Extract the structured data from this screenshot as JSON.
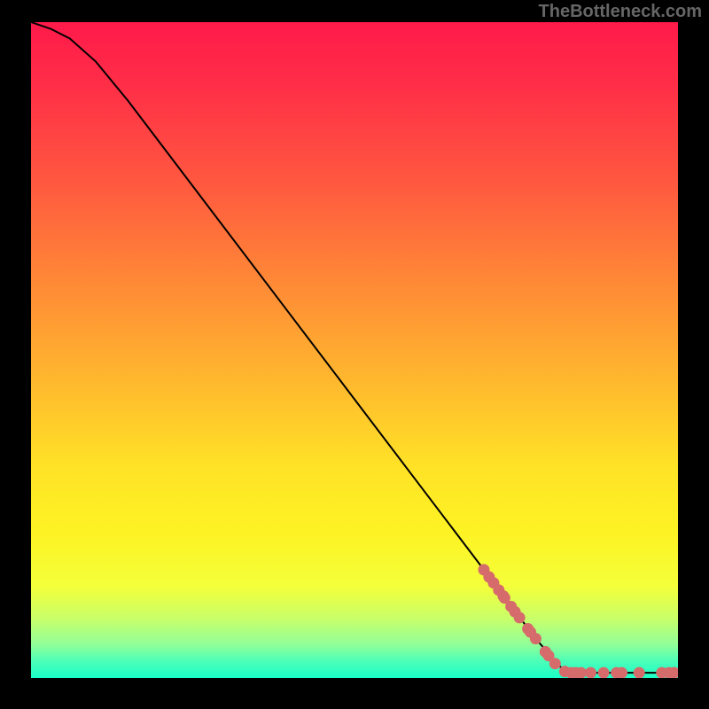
{
  "watermark": "TheBottleneck.com",
  "chart_data": {
    "type": "line",
    "title": "",
    "xlabel": "",
    "ylabel": "",
    "xlim": [
      0,
      100
    ],
    "ylim": [
      0,
      100
    ],
    "gradient_stops": [
      {
        "offset": 0.0,
        "color": "#ff1a4a"
      },
      {
        "offset": 0.1,
        "color": "#ff2f47"
      },
      {
        "offset": 0.25,
        "color": "#ff5a3f"
      },
      {
        "offset": 0.4,
        "color": "#ff8a36"
      },
      {
        "offset": 0.55,
        "color": "#ffb92e"
      },
      {
        "offset": 0.68,
        "color": "#ffe326"
      },
      {
        "offset": 0.78,
        "color": "#fdf324"
      },
      {
        "offset": 0.86,
        "color": "#f4ff3a"
      },
      {
        "offset": 0.91,
        "color": "#c8ff6a"
      },
      {
        "offset": 0.95,
        "color": "#8fff9a"
      },
      {
        "offset": 0.975,
        "color": "#4affb8"
      },
      {
        "offset": 1.0,
        "color": "#1affc8"
      }
    ],
    "curve": [
      {
        "x": 0,
        "y": 100
      },
      {
        "x": 3,
        "y": 99
      },
      {
        "x": 6,
        "y": 97.5
      },
      {
        "x": 10,
        "y": 94
      },
      {
        "x": 15,
        "y": 88
      },
      {
        "x": 20,
        "y": 81.5
      },
      {
        "x": 30,
        "y": 68.5
      },
      {
        "x": 40,
        "y": 55.5
      },
      {
        "x": 50,
        "y": 42.5
      },
      {
        "x": 60,
        "y": 29.5
      },
      {
        "x": 70,
        "y": 16.5
      },
      {
        "x": 78,
        "y": 6
      },
      {
        "x": 82,
        "y": 1.5
      },
      {
        "x": 85,
        "y": 0.8
      },
      {
        "x": 90,
        "y": 0.8
      },
      {
        "x": 95,
        "y": 0.8
      },
      {
        "x": 100,
        "y": 0.8
      }
    ],
    "markers": [
      {
        "x": 70.0,
        "y": 16.5
      },
      {
        "x": 70.8,
        "y": 15.4
      },
      {
        "x": 71.5,
        "y": 14.5
      },
      {
        "x": 72.3,
        "y": 13.4
      },
      {
        "x": 73.0,
        "y": 12.5
      },
      {
        "x": 73.2,
        "y": 12.2
      },
      {
        "x": 74.2,
        "y": 10.9
      },
      {
        "x": 74.8,
        "y": 10.1
      },
      {
        "x": 75.5,
        "y": 9.2
      },
      {
        "x": 76.8,
        "y": 7.5
      },
      {
        "x": 77.2,
        "y": 7.0
      },
      {
        "x": 78.0,
        "y": 6.0
      },
      {
        "x": 79.5,
        "y": 4.0
      },
      {
        "x": 80.0,
        "y": 3.4
      },
      {
        "x": 81.0,
        "y": 2.2
      },
      {
        "x": 82.5,
        "y": 1.0
      },
      {
        "x": 83.5,
        "y": 0.8
      },
      {
        "x": 84.2,
        "y": 0.8
      },
      {
        "x": 85.0,
        "y": 0.8
      },
      {
        "x": 86.5,
        "y": 0.8
      },
      {
        "x": 88.5,
        "y": 0.8
      },
      {
        "x": 90.5,
        "y": 0.8
      },
      {
        "x": 91.3,
        "y": 0.8
      },
      {
        "x": 94.0,
        "y": 0.8
      },
      {
        "x": 97.5,
        "y": 0.8
      },
      {
        "x": 98.6,
        "y": 0.8
      },
      {
        "x": 99.4,
        "y": 0.8
      }
    ],
    "marker_color": "#d66b6b",
    "curve_color": "#000000"
  }
}
